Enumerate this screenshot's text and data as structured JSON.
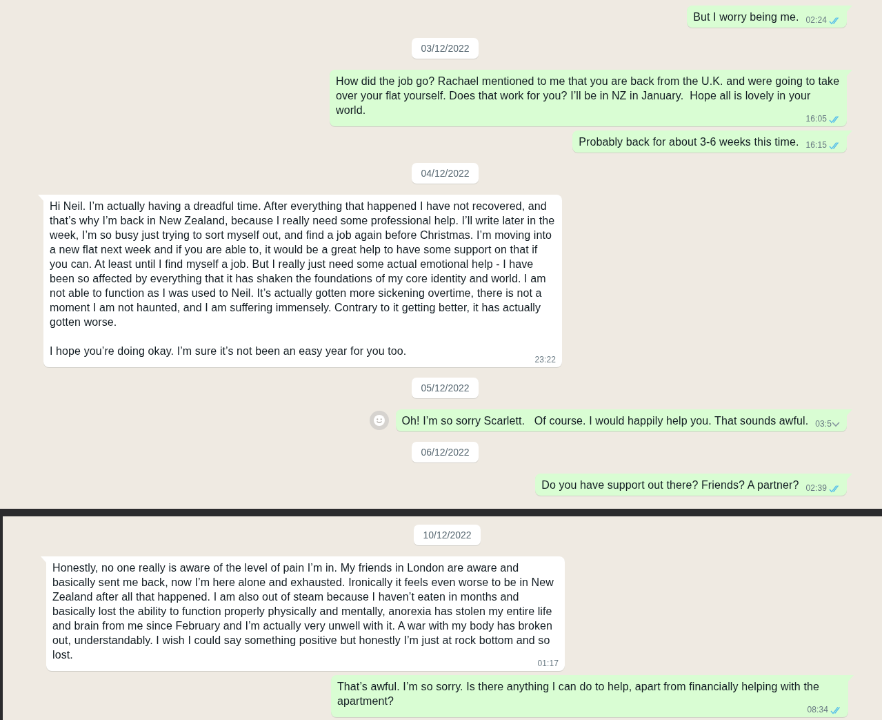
{
  "panels": [
    {
      "items": [
        {
          "kind": "message",
          "outgoing": true,
          "text": "But I worry being me.",
          "time": "02:24",
          "ticks": true,
          "hovered": false
        },
        {
          "kind": "date",
          "text": "03/12/2022"
        },
        {
          "kind": "message",
          "outgoing": true,
          "text": "How did the job go? Rachael mentioned to me that you are back from the U.K. and were going to take over your flat yourself. Does that work for you? I’ll be in NZ in January.  Hope all is lovely in your world.",
          "time": "16:05",
          "ticks": true,
          "hovered": false
        },
        {
          "kind": "message",
          "outgoing": true,
          "text": "Probably back for about 3-6 weeks this time.",
          "time": "16:15",
          "ticks": true,
          "hovered": false
        },
        {
          "kind": "date",
          "text": "04/12/2022"
        },
        {
          "kind": "message",
          "outgoing": false,
          "text": "Hi Neil. I’m actually having a dreadful time. After everything that happened I have not recovered, and that’s why I’m back in New Zealand, because I really need some professional help. I’ll write later in the week, I’m so busy just trying to sort myself out, and find a job again before Christmas. I’m moving into a new flat next week and if you are able to, it would be a great help to have some support on that if you can. At least until I find myself a job. But I really just need some actual emotional help - I have been so affected by everything that it has shaken the foundations of my core identity and world. I am not able to function as I was used to Neil. It’s actually gotten more sickening overtime, there is not a moment I am not haunted, and I am suffering immensely. Contrary to it getting better, it has actually gotten worse.\n\nI hope you’re doing okay. I’m sure it’s not been an easy year for you too.",
          "time": "23:22",
          "ticks": false,
          "hovered": false
        },
        {
          "kind": "date",
          "text": "05/12/2022"
        },
        {
          "kind": "message",
          "outgoing": true,
          "text": "Oh! I’m so sorry Scarlett.   Of course. I would happily help you. That sounds awful.",
          "time": "03:5",
          "ticks": false,
          "hovered": true
        },
        {
          "kind": "date",
          "text": "06/12/2022"
        },
        {
          "kind": "message",
          "outgoing": true,
          "text": "Do you have support out there? Friends? A partner?",
          "time": "02:39",
          "ticks": true,
          "hovered": false
        }
      ]
    },
    {
      "items": [
        {
          "kind": "date",
          "text": "10/12/2022"
        },
        {
          "kind": "message",
          "outgoing": false,
          "text": "Honestly, no one really is aware of the level of pain I’m in. My friends in London are aware and basically sent me back, now I’m here alone and exhausted. Ironically it feels even worse to be in New Zealand after all that happened. I am also out of steam because I haven’t eaten in months and basically lost the ability to function properly physically and mentally, anorexia has stolen my entire life and brain from me since February and I’m actually very unwell with it. A war with my body has broken out, understandably. I wish I could say something positive but honestly I’m just at rock bottom and so lost.",
          "time": "01:17",
          "ticks": false,
          "hovered": false
        },
        {
          "kind": "message",
          "outgoing": true,
          "text": "That’s awful. I’m so sorry. Is there anything I can do to help, apart from financially helping with the apartment?",
          "time": "08:34",
          "ticks": true,
          "hovered": false
        }
      ]
    }
  ]
}
